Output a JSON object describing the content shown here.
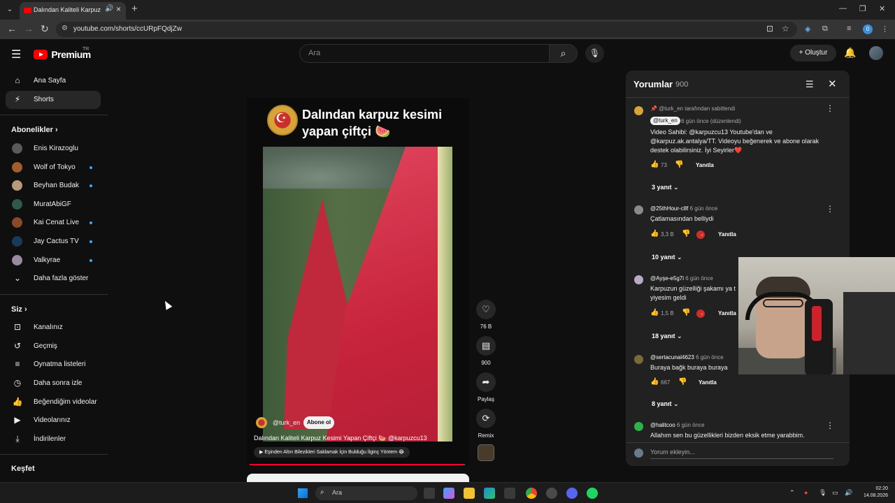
{
  "browser": {
    "tab_title": "Dalından Kaliteli Karpuz Ke",
    "url": "youtube.com/shorts/ccURpFQdjZw",
    "profile_initial": "0"
  },
  "header": {
    "logo": "Premium",
    "country": "TR",
    "search_placeholder": "Ara",
    "create_label": "Oluştur"
  },
  "sidebar": {
    "top": [
      {
        "label": "Ana Sayfa",
        "icon": "home-icon"
      },
      {
        "label": "Shorts",
        "icon": "shorts-icon"
      }
    ],
    "subs_header": "Abonelikler",
    "subscriptions": [
      {
        "label": "Enis Kirazoglu",
        "color": "#5a5a5a",
        "live": false
      },
      {
        "label": "Wolf of Tokyo",
        "color": "#a35c2c",
        "live": true
      },
      {
        "label": "Beyhan Budak",
        "color": "#b89a7a",
        "live": true
      },
      {
        "label": "MuratAbiGF",
        "color": "#2f5a4a",
        "live": false
      },
      {
        "label": "Kai Cenat Live",
        "color": "#8a4a2a",
        "live": true
      },
      {
        "label": "Jay Cactus TV",
        "color": "#1a3a5a",
        "live": true
      },
      {
        "label": "Valkyrae",
        "color": "#9a8aa0",
        "live": true
      }
    ],
    "show_more": "Daha fazla göster",
    "you_header": "Siz",
    "you_items": [
      {
        "label": "Kanalınız",
        "icon": "user-icon"
      },
      {
        "label": "Geçmiş",
        "icon": "history-icon"
      },
      {
        "label": "Oynatma listeleri",
        "icon": "playlist-icon"
      },
      {
        "label": "Daha sonra izle",
        "icon": "clock-icon"
      },
      {
        "label": "Beğendiğim videolar",
        "icon": "like-icon"
      },
      {
        "label": "Videolarınız",
        "icon": "video-icon"
      },
      {
        "label": "İndirilenler",
        "icon": "download-icon"
      }
    ],
    "explore_header": "Keşfet"
  },
  "short": {
    "overlay_title": "Dalından karpuz kesimi yapan çiftçi 🍉",
    "channel": "@turk_en",
    "subscribe": "Abone ol",
    "description": "Dalından Kaliteli Karpuz Kesimi Yapan Çiftçi 🍉 @karpuzcu13",
    "related": "Eşinden Altın Bilezikleri Saklamak İçin Bulduğu İlginç Yöntem 😂",
    "progress": 0.99,
    "likes": "76 B",
    "comments": "900",
    "share": "Paylaş",
    "remix": "Remix"
  },
  "comments_panel": {
    "title": "Yorumlar",
    "count": "900",
    "add_placeholder": "Yorum ekleyin...",
    "comments": [
      {
        "pinned": "@turk_en tarafından sabitlendi",
        "author": "@turk_en",
        "time": "6 gün önce (düzenlendi)",
        "text": "Video Sahibi: @karpuzcu13 Youtube'dan ve @karpuz.ak.antalya/TT. Videoyu beğenerek ve abone olarak destek olabilirsiniz. İyi Seyirler❤️",
        "likes": "73",
        "reply": "Yanıtla",
        "replies": "3 yanıt"
      },
      {
        "author": "@25thHour-c8f",
        "time": "6 gün önce",
        "text": "Çatlamasından belliydi",
        "likes": "3,3 B",
        "reply": "Yanıtla",
        "replies": "10 yanıt"
      },
      {
        "author": "@Ayşe-e5g7i",
        "time": "6 gün önce",
        "text": "Karpuzun güzelliği şakamı ya t",
        "text2": "yiyesim geldi",
        "likes": "1,5 B",
        "reply": "Yanıtla",
        "replies": "18 yanıt"
      },
      {
        "author": "@sertacunal4623",
        "time": "6 gün önce",
        "text": "Buraya bağk buraya buraya",
        "likes": "667",
        "reply": "Yanıtla",
        "replies": "8 yanıt"
      },
      {
        "author": "@halitcoo",
        "time": "6 gün önce",
        "text": "Allahım sen bu güzellikleri bizden eksik etme yarabbim."
      }
    ]
  },
  "taskbar": {
    "search_placeholder": "Ara",
    "time": "02:20",
    "date": "14.08.2026"
  }
}
